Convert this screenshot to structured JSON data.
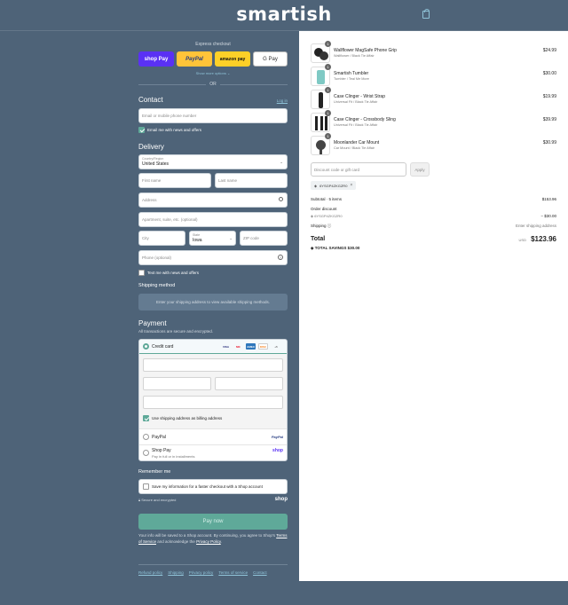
{
  "header": {
    "logo": "smartish"
  },
  "express": {
    "title": "Express checkout",
    "shop_pay": "shop Pay",
    "paypal": "PayPal",
    "amazon_pay": "amazon pay",
    "gpay": "G Pay",
    "show_more": "Show more options ⌄",
    "or": "OR"
  },
  "contact": {
    "title": "Contact",
    "login": "Log in",
    "email_placeholder": "Email or mobile phone number",
    "news_label": "Email me with news and offers",
    "news_checked": true
  },
  "delivery": {
    "title": "Delivery",
    "country_label": "Country/Region",
    "country_value": "United States",
    "first_name": "First name",
    "last_name": "Last name",
    "address": "Address",
    "apartment": "Apartment, suite, etc. (optional)",
    "city": "City",
    "state_label": "State",
    "state_value": "Iowa",
    "zip": "ZIP code",
    "phone": "Phone (optional)",
    "text_label": "Text me with news and offers"
  },
  "shipping": {
    "title": "Shipping method",
    "message": "Enter your shipping address to view available shipping methods."
  },
  "payment": {
    "title": "Payment",
    "subtitle": "All transactions are secure and encrypted.",
    "credit_card": "Credit card",
    "brands": [
      "VISA",
      "MC",
      "AMEX",
      "DISC",
      "+5"
    ],
    "billing_label": "Use shipping address as billing address",
    "paypal": "PayPal",
    "paypal_logo": "PayPal",
    "shop_pay": "Shop Pay",
    "shop_pay_sub": "Pay in full or in installments",
    "shop_logo": "shop"
  },
  "remember": {
    "title": "Remember me",
    "save_label": "Save my information for a faster checkout with a Shop account",
    "secure": "Secure and encrypted",
    "shop_logo": "shop"
  },
  "pay_button": "Pay now",
  "legal": {
    "text1": "Your info will be saved to a Shop account. By continuing, you agree to Shop's",
    "tos": "Terms of Service",
    "text2": "and acknowledge the",
    "privacy": "Privacy Policy",
    "text3": "."
  },
  "footer": [
    "Refund policy",
    "Shipping",
    "Privacy policy",
    "Terms of service",
    "Contact"
  ],
  "cart": {
    "items": [
      {
        "name": "Wallflower MagSafe Phone Grip",
        "variant": "Wallflower / Black Tie Affair",
        "price": "$24.99",
        "qty": "1"
      },
      {
        "name": "Smartish Tumbler",
        "variant": "Tumbler / Teal Me More",
        "price": "$30.00",
        "qty": "1"
      },
      {
        "name": "Case Clinger - Wrist Strap",
        "variant": "Universal Fit / Black Tie Affair",
        "price": "$19.99",
        "qty": "1"
      },
      {
        "name": "Case Clinger - Crossbody Sling",
        "variant": "Universal Fit / Black Tie Affair",
        "price": "$39.99",
        "qty": "1"
      },
      {
        "name": "Moonlander Car Mount",
        "variant": "Car Mount / Black Tie Affair",
        "price": "$30.99",
        "qty": "1"
      }
    ],
    "discount_placeholder": "Discount code or gift card",
    "apply": "Apply",
    "applied_code": "6YSGP4ZKGZR0",
    "subtotal_label": "Subtotal · 5 items",
    "subtotal_value": "$153.96",
    "order_discount_label": "Order discount",
    "order_discount_code": "6YSGP4ZKGZR0",
    "order_discount_value": "− $30.00",
    "shipping_label": "Shipping",
    "shipping_value": "Enter shipping address",
    "total_label": "Total",
    "currency": "USD",
    "total_value": "$123.96",
    "savings_label": "TOTAL SAVINGS",
    "savings_value": "$30.00"
  },
  "colors": {
    "accent": "#5fa999",
    "background": "#4e6378",
    "shop_pay": "#5a31f4"
  }
}
